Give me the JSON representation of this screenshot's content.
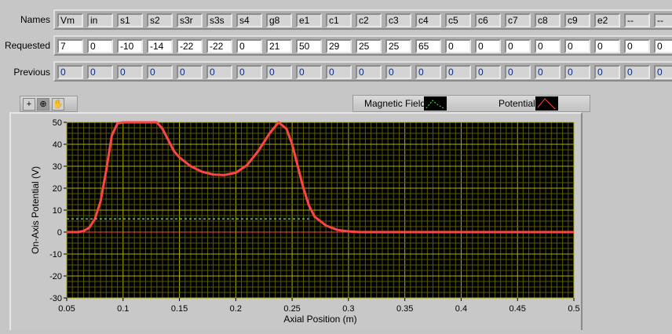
{
  "row_labels": {
    "names": "Names",
    "requested": "Requested",
    "previous": "Previous"
  },
  "names": [
    "Vm",
    "in",
    "s1",
    "s2",
    "s3r",
    "s3s",
    "s4",
    "g8",
    "e1",
    "c1",
    "c2",
    "c3",
    "c4",
    "c5",
    "c6",
    "c7",
    "c8",
    "c9",
    "e2",
    "--",
    "--"
  ],
  "requested": [
    "7",
    "0",
    "-10",
    "-14",
    "-22",
    "-22",
    "0",
    "21",
    "50",
    "29",
    "25",
    "25",
    "65",
    "0",
    "0",
    "0",
    "0",
    "0",
    "0",
    "0",
    "0"
  ],
  "previous": [
    "0",
    "0",
    "0",
    "0",
    "0",
    "0",
    "0",
    "0",
    "0",
    "0",
    "0",
    "0",
    "0",
    "0",
    "0",
    "0",
    "0",
    "0",
    "0",
    "0",
    "0"
  ],
  "graph_tools": [
    "cursor-tool-icon",
    "zoom-tool-icon",
    "pan-tool-icon"
  ],
  "legend": [
    {
      "label": "Magnetic Field (T)",
      "color": "#33ff33"
    },
    {
      "label": "Potential (V)",
      "color": "#ff4444"
    }
  ],
  "chart_data": {
    "type": "line",
    "xlabel": "Axial Position (m)",
    "ylabel": "On-Axis Potential (V)",
    "xlim": [
      0.05,
      0.5
    ],
    "ylim": [
      -30,
      50
    ],
    "xticks": [
      "0.05",
      "0.1",
      "0.15",
      "0.2",
      "0.25",
      "0.3",
      "0.35",
      "0.4",
      "0.45",
      "0.5"
    ],
    "yticks": [
      "50",
      "40",
      "30",
      "20",
      "10",
      "0",
      "-10",
      "-20",
      "-30"
    ],
    "grid": true,
    "series": [
      {
        "name": "Potential (V)",
        "color": "#ff4444",
        "x": [
          0.05,
          0.06,
          0.065,
          0.07,
          0.075,
          0.08,
          0.085,
          0.09,
          0.095,
          0.1,
          0.13,
          0.135,
          0.14,
          0.145,
          0.15,
          0.16,
          0.17,
          0.18,
          0.19,
          0.2,
          0.21,
          0.22,
          0.23,
          0.238,
          0.245,
          0.25,
          0.255,
          0.26,
          0.265,
          0.27,
          0.28,
          0.29,
          0.3,
          0.31,
          0.5
        ],
        "y": [
          0,
          0,
          0.5,
          2,
          6,
          14,
          28,
          44,
          49.5,
          50,
          50,
          47,
          42,
          37,
          34,
          30,
          27.5,
          26.2,
          26,
          27,
          30.5,
          37,
          45,
          50,
          47,
          40,
          30,
          20,
          12,
          7,
          3,
          1,
          0.3,
          0,
          0
        ]
      },
      {
        "name": "Magnetic Field (T)",
        "color": "#33ff33",
        "dashed": true,
        "x": [
          0.05,
          0.265
        ],
        "y": [
          6,
          6
        ]
      }
    ]
  }
}
